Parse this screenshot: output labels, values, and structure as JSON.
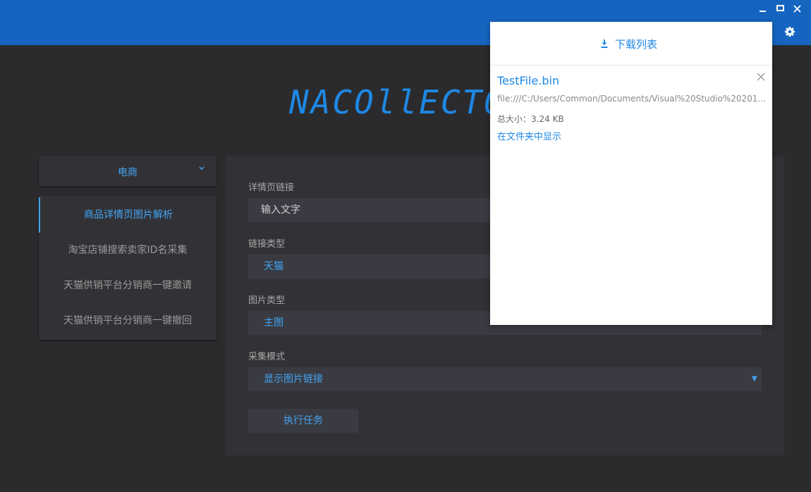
{
  "window": {
    "minimize_icon": "minimize-icon",
    "maximize_icon": "maximize-icon",
    "close_icon": "close-icon",
    "settings_icon": "gear-icon",
    "titlebar_color": "#1565c0"
  },
  "logo": {
    "text": "NACOllECTO"
  },
  "sidebar": {
    "category": "电商",
    "items": [
      {
        "label": "商品详情页图片解析",
        "active": true
      },
      {
        "label": "淘宝店铺搜索卖家ID名采集",
        "active": false
      },
      {
        "label": "天猫供销平台分销商一键邀请",
        "active": false
      },
      {
        "label": "天猫供销平台分销商一键撤回",
        "active": false
      }
    ]
  },
  "form": {
    "detail_link": {
      "label": "详情页链接",
      "placeholder": "输入文字"
    },
    "link_type": {
      "label": "链接类型",
      "value": "天猫"
    },
    "image_type": {
      "label": "图片类型",
      "value": "主图"
    },
    "collect_mode": {
      "label": "采集模式",
      "value": "显示图片链接"
    },
    "run_button": "执行任务"
  },
  "downloads": {
    "title": "下载列表",
    "items": [
      {
        "name": "TestFile.bin",
        "path": "file:///C:/Users/Common/Documents/Visual%20Studio%202017/...",
        "size": "总大小：3.24 KB",
        "show_in_folder": "在文件夹中显示"
      }
    ]
  },
  "colors": {
    "accent": "#1e88e5",
    "background": "#2b2b2d",
    "panel": "#323236"
  }
}
